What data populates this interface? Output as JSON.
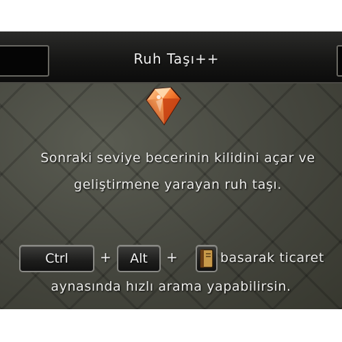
{
  "item": {
    "title": "Ruh Taşı++",
    "icon": "fire-soul-stone-icon",
    "description": "Sonraki seviye becerinin kilidini açar ve geliştirmene yarayan ruh taşı."
  },
  "trade_hint": {
    "key_ctrl": "Ctrl",
    "plus": "+",
    "key_alt": "Alt",
    "key_book_icon": "book-icon",
    "tail": "basarak ticaret",
    "line2": "aynasında hızlı arama yapabilirsin."
  },
  "colors": {
    "title_bar": "#151514",
    "panel_background": "#45463e",
    "text": "#ececea",
    "gem_orange": "#e8621a"
  }
}
